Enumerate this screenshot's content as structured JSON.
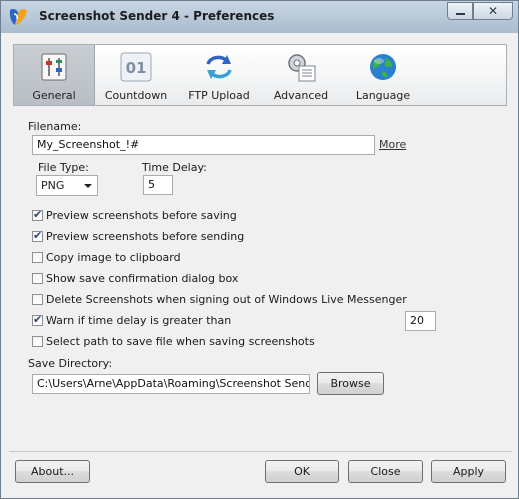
{
  "window": {
    "title": "Screenshot Sender 4 - Preferences",
    "minimize_glyph": "—",
    "close_glyph": "✕"
  },
  "tabs": [
    {
      "label": "General",
      "icon": "general-settings-icon",
      "active": true
    },
    {
      "label": "Countdown",
      "icon": "countdown-icon",
      "icon_text": "01",
      "active": false
    },
    {
      "label": "FTP Upload",
      "icon": "ftp-upload-icon",
      "active": false
    },
    {
      "label": "Advanced",
      "icon": "advanced-icon",
      "active": false
    },
    {
      "label": "Language",
      "icon": "globe-icon",
      "active": false
    }
  ],
  "general": {
    "filename_label": "Filename:",
    "filename_value": "My_Screenshot_!#",
    "more_link": "More",
    "filetype_label": "File Type:",
    "filetype_value": "PNG",
    "timedelay_label": "Time Delay:",
    "timedelay_value": "5",
    "options": [
      {
        "label": "Preview screenshots before saving",
        "checked": true
      },
      {
        "label": "Preview screenshots before sending",
        "checked": true
      },
      {
        "label": "Copy image to clipboard",
        "checked": false
      },
      {
        "label": "Show save confirmation dialog box",
        "checked": false
      },
      {
        "label": "Delete Screenshots when signing out of Windows Live Messenger",
        "checked": false
      },
      {
        "label": "Warn if time delay is greater than",
        "checked": true
      },
      {
        "label": "Select path to save file when saving screenshots",
        "checked": false
      }
    ],
    "warn_value": "20",
    "savedir_label": "Save Directory:",
    "savedir_value": "C:\\Users\\Arne\\AppData\\Roaming\\Screenshot Sender\\ar",
    "browse_label": "Browse"
  },
  "footer": {
    "about_label": "About...",
    "ok_label": "OK",
    "close_label": "Close",
    "apply_label": "Apply"
  },
  "colors": {
    "titlebar": "#b7c8d8",
    "dialog_bg": "#f0f0f0",
    "check_mark": "#2a4a78"
  }
}
